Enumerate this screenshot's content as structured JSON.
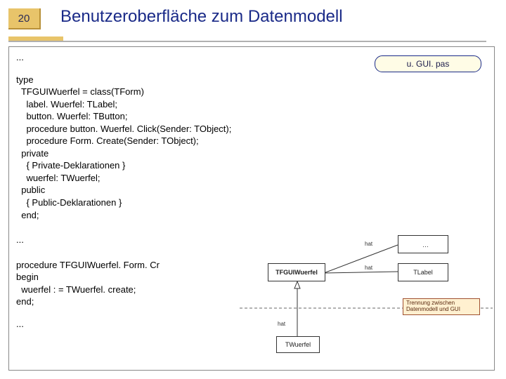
{
  "slide": {
    "number": "20",
    "title": "Benutzeroberfläche zum Datenmodell"
  },
  "file_badge": "u. GUI. pas",
  "code": {
    "l0": "...",
    "l1": "type",
    "l2": "  TFGUIWuerfel = class(TForm)",
    "l3": "    label. Wuerfel: TLabel;",
    "l4": "    button. Wuerfel: TButton;",
    "l5": "    procedure button. Wuerfel. Click(Sender: TObject);",
    "l6": "    procedure Form. Create(Sender: TObject);",
    "l7": "  private",
    "l8": "    { Private-Deklarationen }",
    "l9": "    wuerfel: TWuerfel;",
    "l10": "  public",
    "l11": "    { Public-Deklarationen }",
    "l12": "  end;",
    "l13": "...",
    "l14": "procedure TFGUIWuerfel. Form. Cr",
    "l15": "begin",
    "l16": "  wuerfel : = TWuerfel. create;",
    "l17": "end;",
    "l18": "..."
  },
  "diagram": {
    "main": "TFGUIWuerfel",
    "right_top": "",
    "right_bot": "TLabel",
    "bottom": "TWuerfel",
    "edge1": "hat",
    "edge2": "hat",
    "edge3": "hat",
    "note_l1": "Trennung zwischen",
    "note_l2": "Datenmodell und GUI"
  }
}
